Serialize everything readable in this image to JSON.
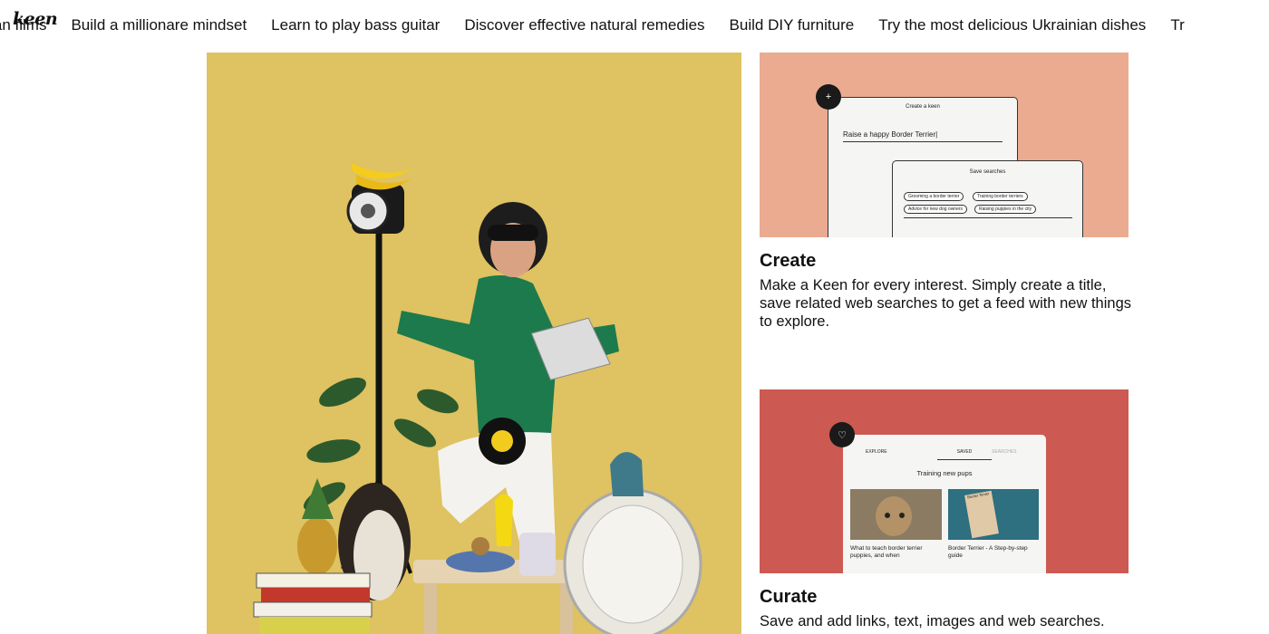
{
  "brand": {
    "logo": "keen"
  },
  "topics": [
    "American films",
    "Build a millionare mindset",
    "Learn to play bass guitar",
    "Discover effective natural remedies",
    "Build DIY furniture",
    "Try the most delicious Ukrainian dishes",
    "Tr"
  ],
  "create_card": {
    "mock_title": "Create a keen",
    "input_value": "Raise a happy Border Terrier|",
    "save_title": "Save searches",
    "chips": [
      "Grooming a border terrier",
      "Training border terriers",
      "Advice for new dog owners",
      "Raising puppies in the city"
    ],
    "plus": "+",
    "title": "Create",
    "text": "Make a Keen for every interest. Simply create a title, save related web searches to get a feed with new things to explore."
  },
  "curate_card": {
    "tabs": [
      "EXPLORE",
      "SAVED",
      "SEARCHES"
    ],
    "heading": "Training new pups",
    "item1": "What to teach border terrier puppies, and when",
    "item2": "Border Terrier - A Step-by-step guide",
    "book_text": "Border Terrier",
    "title": "Curate",
    "text": "Save and add links, text, images and web searches."
  },
  "colors": {
    "hero_bg": "#dfc261",
    "create_bg": "#eaab90",
    "curate_bg": "#cc5a52"
  }
}
